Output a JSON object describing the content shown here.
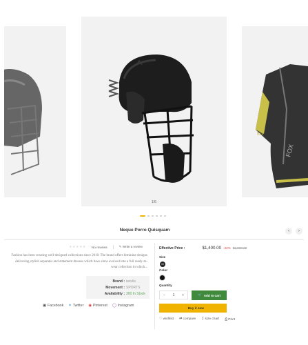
{
  "gallery": {
    "counter": "1/6",
    "dot_count": 6,
    "active_dot": 0
  },
  "product": {
    "title": "Neque Porro Quisquam",
    "reviews_label": "No reviews",
    "write_review_label": "Write a review",
    "description": "Fashion has been creating well-designed collections since 2010. The brand offers feminine designs delivering stylish separates and statement dresses which have since evolved into a full ready-to-wear collection in which...",
    "info": [
      {
        "key": "Brand :",
        "value": "iaculis"
      },
      {
        "key": "Movement :",
        "value": "SPORTS"
      },
      {
        "key": "Availability :",
        "value": "300 In Stock"
      }
    ],
    "share": [
      {
        "icon": "facebook-icon",
        "label": "Facebook"
      },
      {
        "icon": "twitter-icon",
        "label": "Twitter"
      },
      {
        "icon": "pinterest-icon",
        "label": "Pinterest"
      },
      {
        "icon": "instagram-icon",
        "label": "Instagram"
      }
    ]
  },
  "purchase": {
    "price_label": "Effective Price :",
    "price": "$1,400.00",
    "discount": "-22%",
    "old_price": "$1,800.00",
    "size_label": "Size",
    "size_value": "M",
    "color_label": "Color",
    "quantity_label": "Quantity",
    "quantity_value": "1",
    "minus": "−",
    "plus": "+",
    "add_to_cart": "Add to cart",
    "buy_now": "Buy it now",
    "tools": [
      {
        "icon": "heart-icon",
        "label": "wishlist"
      },
      {
        "icon": "compare-icon",
        "label": "compare"
      },
      {
        "icon": "ruler-icon",
        "label": "size chart"
      },
      {
        "icon": "print-icon",
        "label": "Print"
      }
    ]
  },
  "colors": {
    "accent": "#f0b400",
    "cart_green": "#3f8a3c",
    "discount_red": "#e03b3b",
    "stock_green": "#5aa95a"
  }
}
